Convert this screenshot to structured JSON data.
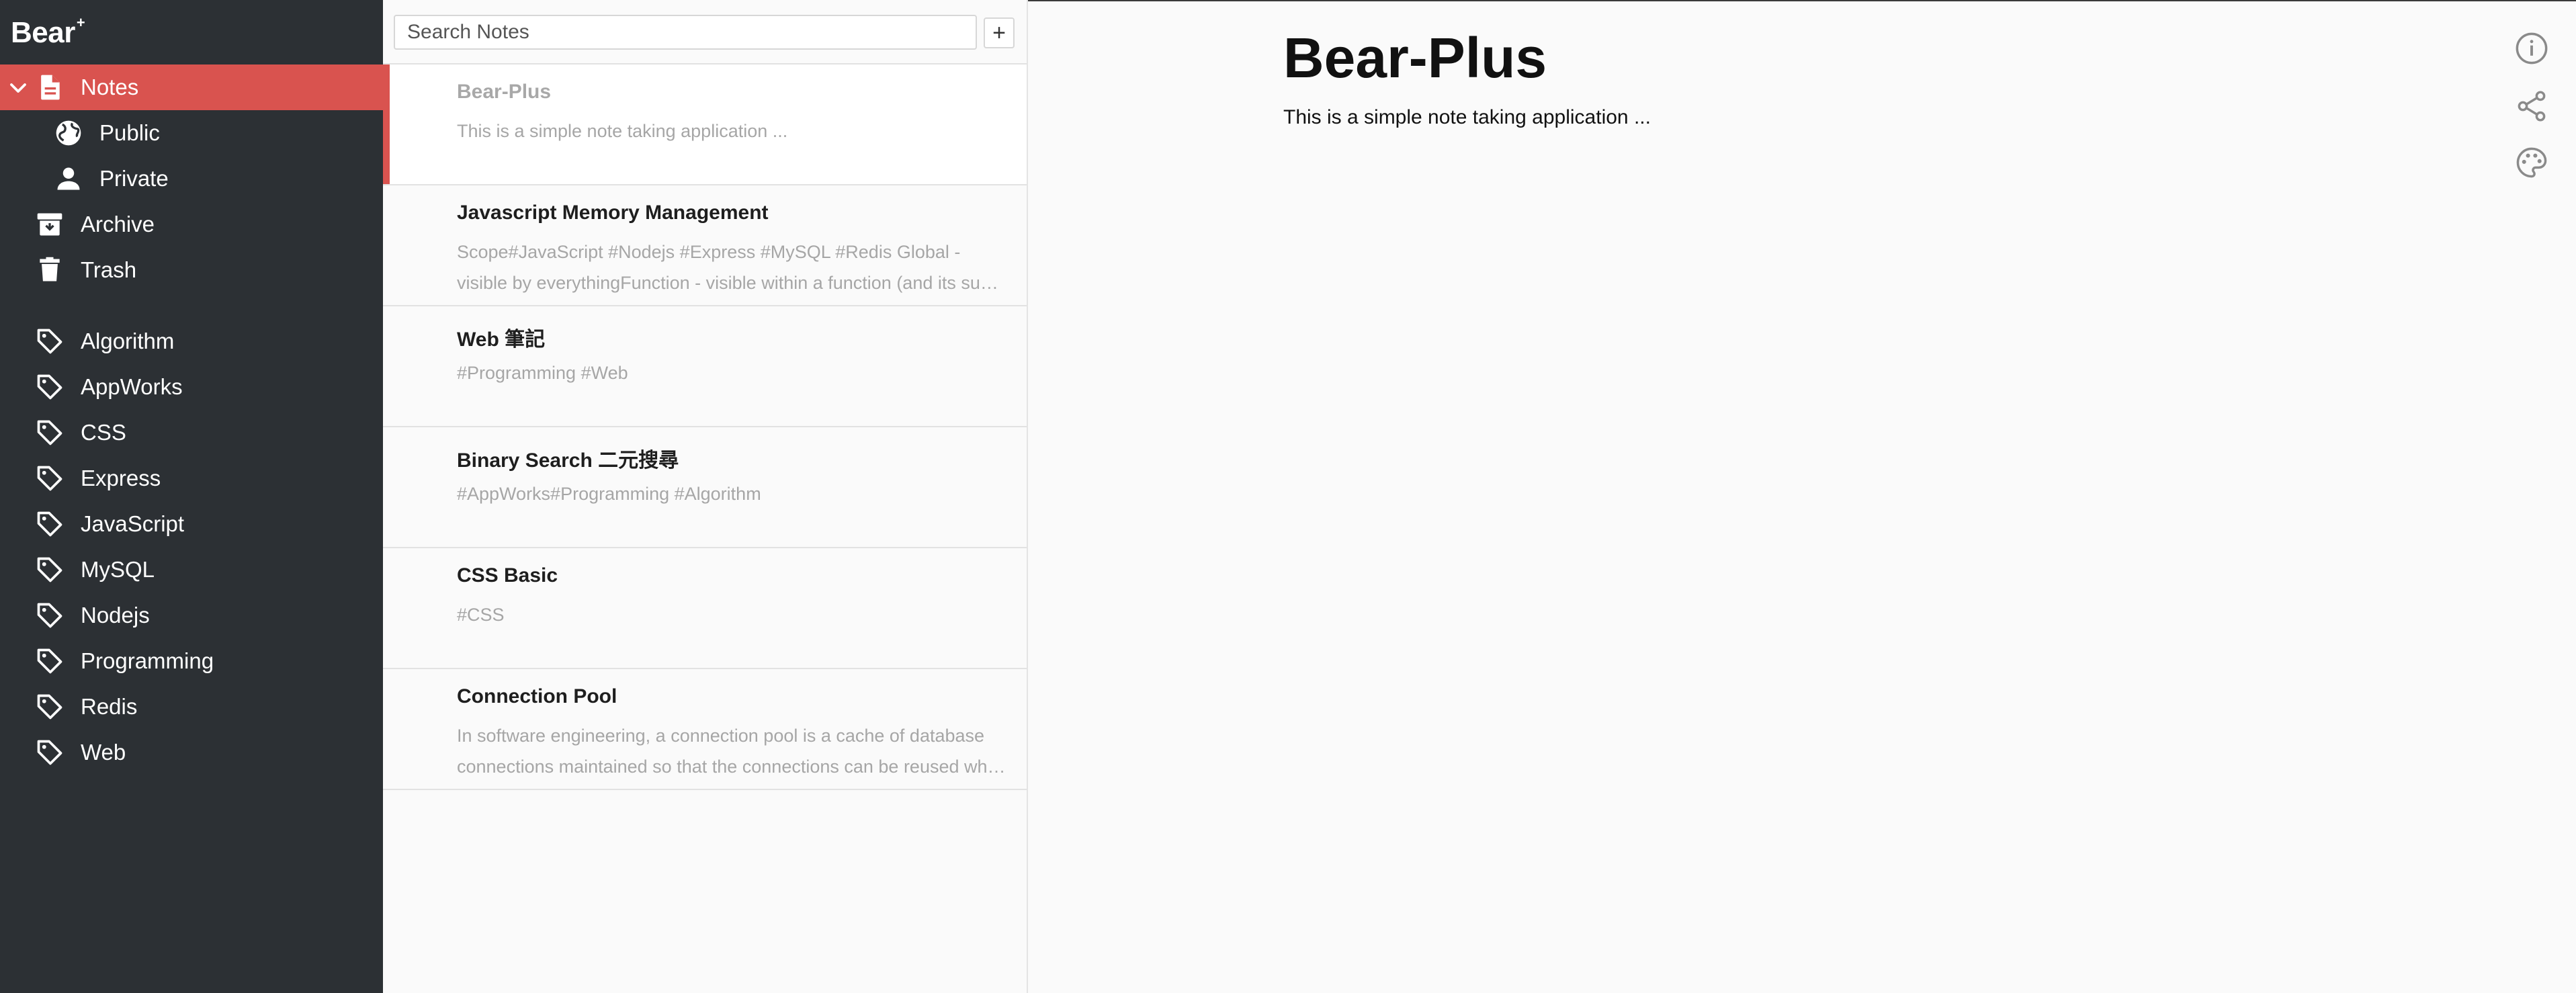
{
  "app": {
    "logo": "Bear",
    "logo_mark": "+"
  },
  "sidebar": {
    "accent_color": "#d9534f",
    "background_color": "#2c3034",
    "notes": {
      "label": "Notes",
      "icon": "note-icon",
      "expanded": true,
      "active": true
    },
    "children": [
      {
        "label": "Public",
        "icon": "globe-icon"
      },
      {
        "label": "Private",
        "icon": "person-icon"
      }
    ],
    "archive": {
      "label": "Archive",
      "icon": "archive-icon"
    },
    "trash": {
      "label": "Trash",
      "icon": "trash-icon"
    },
    "tags": [
      {
        "label": "Algorithm",
        "icon": "tag-icon"
      },
      {
        "label": "AppWorks",
        "icon": "tag-icon"
      },
      {
        "label": "CSS",
        "icon": "tag-icon"
      },
      {
        "label": "Express",
        "icon": "tag-icon"
      },
      {
        "label": "JavaScript",
        "icon": "tag-icon"
      },
      {
        "label": "MySQL",
        "icon": "tag-icon"
      },
      {
        "label": "Nodejs",
        "icon": "tag-icon"
      },
      {
        "label": "Programming",
        "icon": "tag-icon"
      },
      {
        "label": "Redis",
        "icon": "tag-icon"
      },
      {
        "label": "Web",
        "icon": "tag-icon"
      }
    ]
  },
  "notelist": {
    "search": {
      "placeholder": "Search Notes",
      "value": ""
    },
    "add_label": "+",
    "notes": [
      {
        "title": "Bear-Plus",
        "snippet": "This is a simple note taking application ...",
        "selected": true
      },
      {
        "title": "Javascript Memory Management",
        "snippet": "Scope#JavaScript #Nodejs #Express #MySQL #Redis Global - visible by everythingFunction - visible within a function (and its sub-functions and blocks)",
        "selected": false
      },
      {
        "title": "Web 筆記",
        "snippet": "#Programming #Web",
        "selected": false
      },
      {
        "title": "Binary Search 二元搜尋",
        "snippet": "#AppWorks#Programming #Algorithm",
        "selected": false
      },
      {
        "title": "CSS Basic",
        "snippet": "#CSS",
        "selected": false
      },
      {
        "title": "Connection Pool",
        "snippet": "In software engineering, a connection pool is a cache of database connections maintained so that the connections can be reused when future requests to the database are required.",
        "selected": false
      }
    ]
  },
  "editor": {
    "title": "Bear-Plus",
    "body": "This is a simple note taking application ...",
    "tools": [
      {
        "name": "info-icon"
      },
      {
        "name": "share-icon"
      },
      {
        "name": "palette-icon"
      }
    ]
  }
}
